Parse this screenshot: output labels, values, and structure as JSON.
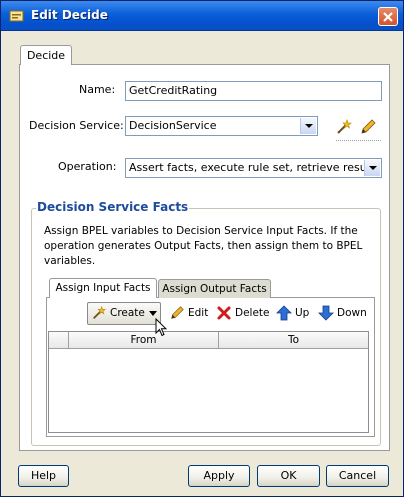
{
  "window": {
    "title": "Edit Decide"
  },
  "tab": {
    "label": "Decide"
  },
  "form": {
    "name_label": "Name:",
    "name_value": "GetCreditRating",
    "decision_service_label": "Decision Service:",
    "decision_service_value": "DecisionService",
    "operation_label": "Operation:",
    "operation_value": "Assert facts, execute rule set, retrieve results..."
  },
  "facts_group": {
    "title": "Decision Service Facts",
    "description": "Assign BPEL variables to Decision Service Input Facts. If the operation generates Output Facts, then assign them to BPEL variables.",
    "tabs": [
      {
        "label": "Assign Input Facts",
        "active": true
      },
      {
        "label": "Assign Output Facts",
        "active": false
      }
    ],
    "toolbar": {
      "create": "Create",
      "edit": "Edit",
      "delete": "Delete",
      "up": "Up",
      "down": "Down"
    },
    "table": {
      "columns": [
        "From",
        "To"
      ],
      "rows": []
    }
  },
  "buttons": {
    "help": "Help",
    "apply": "Apply",
    "ok": "OK",
    "cancel": "Cancel"
  },
  "colors": {
    "titlebar": "#0a5fd8",
    "group_title": "#1e4b9b",
    "close_button": "#d2542c"
  }
}
